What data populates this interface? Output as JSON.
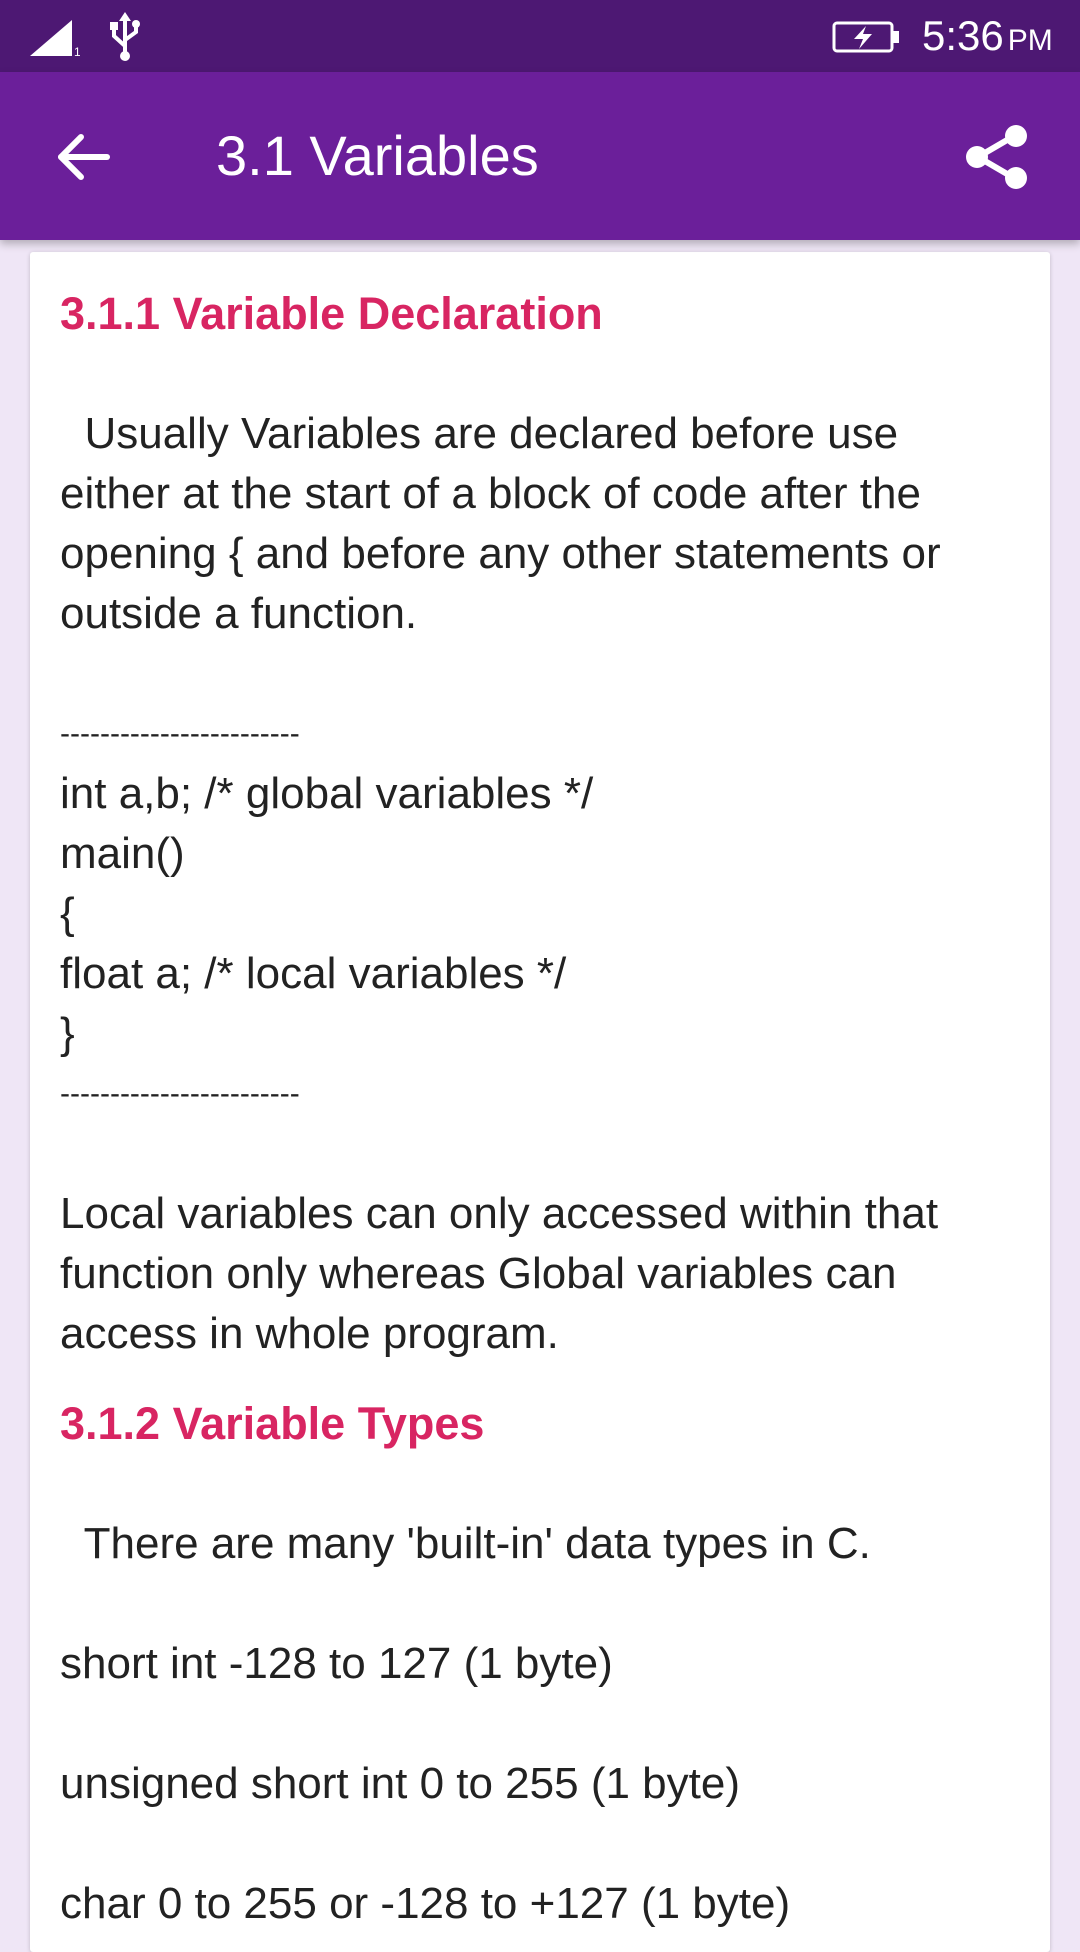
{
  "status_bar": {
    "time": "5:36",
    "ampm": "PM",
    "sim_slot": "1",
    "icons": [
      "signal-icon",
      "usb-icon",
      "battery-charging-icon"
    ]
  },
  "app_bar": {
    "title": "3.1 Variables",
    "icons": [
      "back-arrow-icon",
      "share-icon"
    ]
  },
  "content": {
    "section1_heading": "3.1.1 Variable Declaration",
    "intro_lines": [
      "  Usually Variables are declared before use",
      "either at the start of a block of code after the",
      "opening { and before any other statements or",
      "outside a function."
    ],
    "separator": "------------------------",
    "code_lines": [
      "int a,b; /* global variables */",
      "main()",
      "{",
      "float a; /* local variables */",
      "}"
    ],
    "scope_lines": [
      "Local variables can only accessed within that",
      "function only whereas Global variables can",
      "access in whole program."
    ],
    "section2_heading": "3.1.2 Variable Types",
    "types_intro": "  There are many 'built-in' data types in C.",
    "type_lines": [
      "short int -128 to 127 (1 byte)",
      "unsigned short int 0 to 255 (1 byte)",
      "char 0 to 255 or -128 to +127 (1 byte)"
    ]
  },
  "colors": {
    "status_bar": "#4d1873",
    "app_bar": "#6b1f9a",
    "heading": "#d82562",
    "background": "#efe6f6"
  }
}
